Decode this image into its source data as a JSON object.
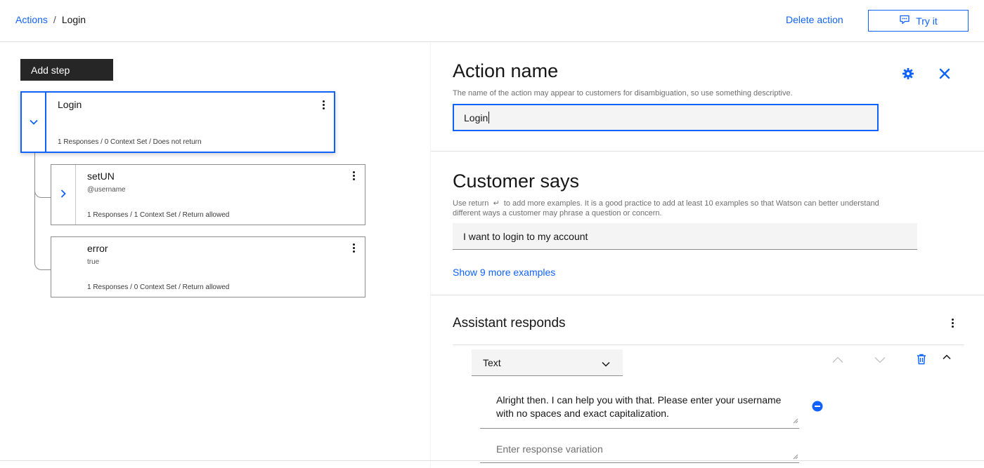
{
  "header": {
    "breadcrumb": {
      "root": "Actions",
      "separator": "/",
      "current": "Login"
    },
    "delete_label": "Delete action",
    "try_label": "Try it"
  },
  "left": {
    "add_step_label": "Add step",
    "steps": [
      {
        "title": "Login",
        "condition": "",
        "meta": "1 Responses / 0 Context Set / Does not return",
        "toggle_icon": "chevron-down-icon"
      },
      {
        "title": "setUN",
        "condition": "@username",
        "meta": "1 Responses / 1 Context Set / Return allowed",
        "toggle_icon": "chevron-right-icon"
      },
      {
        "title": "error",
        "condition": "true",
        "meta": "1 Responses / 0 Context Set / Return allowed",
        "toggle_icon": ""
      }
    ]
  },
  "right": {
    "action_name": {
      "title": "Action name",
      "helper": "The name of the action may appear to customers for disambiguation, so use something descriptive.",
      "value": "Login"
    },
    "customer_says": {
      "title": "Customer says",
      "helper_line1": "Use return  ↵  to add more examples. It is a good practice to add at least 10 examples so that Watson can better understand",
      "helper_line2": "different ways a customer may phrase a question or concern.",
      "example": "I want to login to my account",
      "show_more": "Show 9 more examples"
    },
    "assistant_responds": {
      "title": "Assistant responds",
      "type": "Text",
      "response_line1": "Alright then. I can help you with that. Please enter your username",
      "response_line2": "with no spaces and exact capitalization.",
      "variation_placeholder": "Enter response variation"
    }
  },
  "colors": {
    "accent": "#0f62fe",
    "dark": "#262626"
  }
}
